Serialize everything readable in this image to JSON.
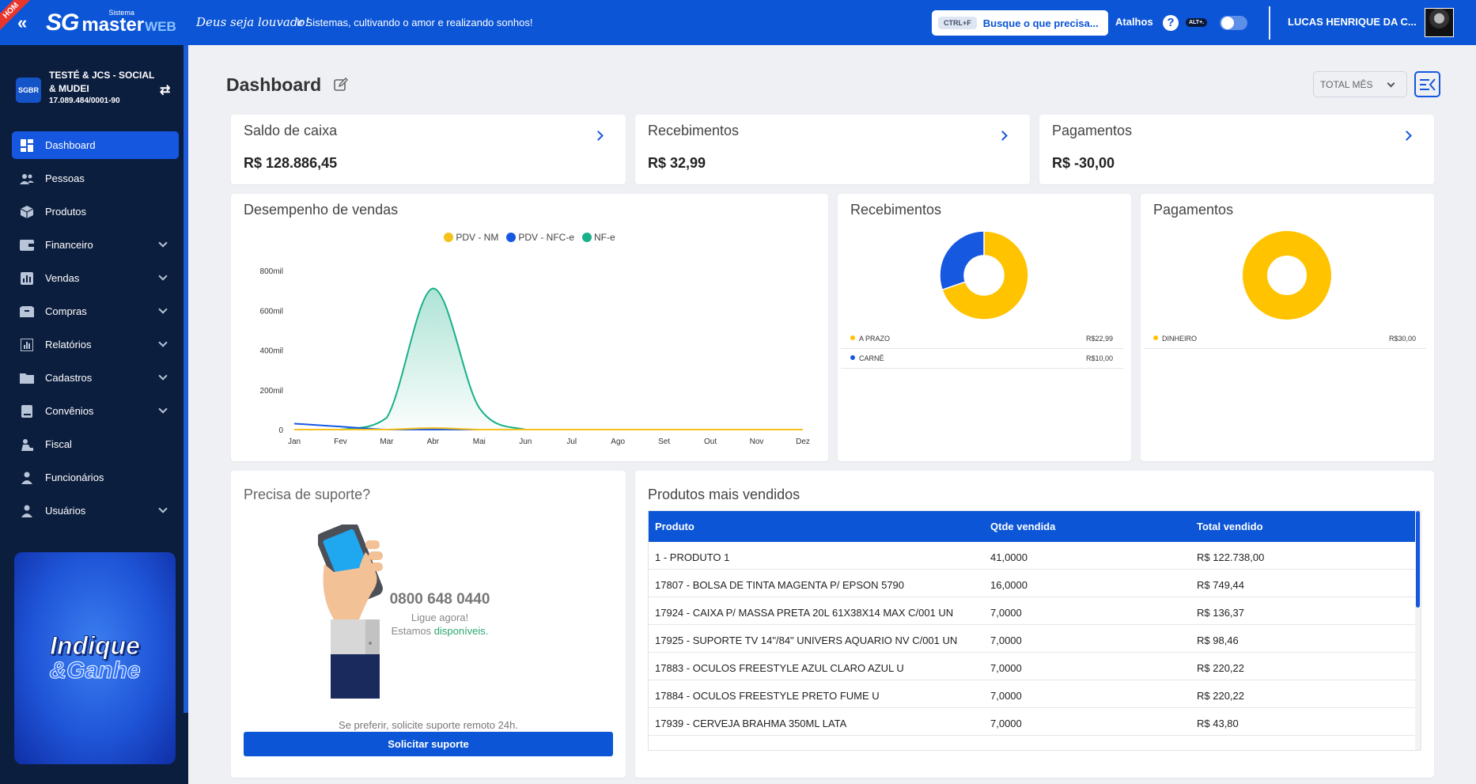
{
  "topbar": {
    "env_badge": "HOM",
    "logo_sg": "SG",
    "logo_sistema": "Sistema",
    "logo_master": "master",
    "logo_web": "WEB",
    "motto": "Deus seja louvado!",
    "tagline": "Ir Sistemas, cultivando o amor e realizando sonhos!",
    "search_shortcut": "CTRL+F",
    "search_placeholder": "Busque o que precisa...",
    "atalhos_label": "Atalhos",
    "help_shortcut": "ALT+.",
    "user_name": "LUCAS HENRIQUE DA C..."
  },
  "company": {
    "logo_text": "SGBR",
    "name": "TESTÉ & JCS - SOCIAL & MUDEI",
    "cnpj": "17.089.484/0001-90"
  },
  "menu": [
    {
      "label": "Dashboard",
      "icon": "dashboard-icon",
      "active": true,
      "expandable": false
    },
    {
      "label": "Pessoas",
      "icon": "people-icon",
      "active": false,
      "expandable": false
    },
    {
      "label": "Produtos",
      "icon": "box-icon",
      "active": false,
      "expandable": false
    },
    {
      "label": "Financeiro",
      "icon": "wallet-icon",
      "active": false,
      "expandable": true
    },
    {
      "label": "Vendas",
      "icon": "sales-icon",
      "active": false,
      "expandable": true
    },
    {
      "label": "Compras",
      "icon": "purchases-icon",
      "active": false,
      "expandable": true
    },
    {
      "label": "Relatórios",
      "icon": "report-icon",
      "active": false,
      "expandable": true
    },
    {
      "label": "Cadastros",
      "icon": "folder-icon",
      "active": false,
      "expandable": true
    },
    {
      "label": "Convênios",
      "icon": "book-icon",
      "active": false,
      "expandable": true
    },
    {
      "label": "Fiscal",
      "icon": "fiscal-icon",
      "active": false,
      "expandable": false
    },
    {
      "label": "Funcionários",
      "icon": "employee-icon",
      "active": false,
      "expandable": false
    },
    {
      "label": "Usuários",
      "icon": "user-icon",
      "active": false,
      "expandable": true
    }
  ],
  "promo": {
    "line1": "Indique",
    "line2": "&Ganhe"
  },
  "page": {
    "title": "Dashboard",
    "period": "TOTAL MÊS"
  },
  "summary": [
    {
      "title": "Saldo de caixa",
      "value": "R$ 128.886,45"
    },
    {
      "title": "Recebimentos",
      "value": "R$ 32,99"
    },
    {
      "title": "Pagamentos",
      "value": "R$ -30,00"
    }
  ],
  "sales_chart": {
    "title": "Desempenho de vendas",
    "chart_data": {
      "type": "area",
      "categories": [
        "Jan",
        "Fev",
        "Mar",
        "Abr",
        "Mai",
        "Jun",
        "Jul",
        "Ago",
        "Set",
        "Out",
        "Nov",
        "Dez"
      ],
      "y_ticks": [
        "0",
        "200mil",
        "400mil",
        "600mil",
        "800mil"
      ],
      "ylim": [
        0,
        800000
      ],
      "series": [
        {
          "name": "PDV - NM",
          "color": "#f6c11b",
          "values": [
            0,
            0,
            0,
            8000,
            0,
            0,
            0,
            0,
            0,
            0,
            0,
            0
          ]
        },
        {
          "name": "PDV - NFC-e",
          "color": "#1758e0",
          "values": [
            30000,
            15000,
            0,
            0,
            0,
            0,
            0,
            0,
            0,
            0,
            0,
            0
          ]
        },
        {
          "name": "NF-e",
          "color": "#19b089",
          "values": [
            0,
            0,
            60000,
            710000,
            110000,
            0,
            0,
            0,
            0,
            0,
            0,
            0
          ]
        }
      ]
    }
  },
  "receipts_chart": {
    "title": "Recebimentos",
    "chart_data": {
      "type": "pie",
      "slices": [
        {
          "label": "A PRAZO",
          "value": 22.99,
          "display": "R$22,99",
          "color": "#ffc300"
        },
        {
          "label": "CARNÊ",
          "value": 10.0,
          "display": "R$10,00",
          "color": "#1758e0"
        }
      ]
    }
  },
  "payments_chart": {
    "title": "Pagamentos",
    "chart_data": {
      "type": "pie",
      "slices": [
        {
          "label": "DINHEIRO",
          "value": 30.0,
          "display": "R$30,00",
          "color": "#ffc300"
        }
      ]
    }
  },
  "support": {
    "title": "Precisa de suporte?",
    "phone": "0800 648 0440",
    "call_now": "Ligue agora!",
    "available_prefix": "Estamos ",
    "available_highlight": "disponíveis.",
    "remote_text": "Se preferir, solicite suporte remoto 24h.",
    "button_label": "Solicitar suporte"
  },
  "products": {
    "title": "Produtos mais vendidos",
    "columns": [
      "Produto",
      "Qtde vendida",
      "Total vendido"
    ],
    "rows": [
      [
        "1 - PRODUTO 1",
        "41,0000",
        "R$ 122.738,00"
      ],
      [
        "17807 - BOLSA DE TINTA MAGENTA P/ EPSON 5790",
        "16,0000",
        "R$ 749,44"
      ],
      [
        "17924 - CAIXA P/ MASSA PRETA 20L 61X38X14 MAX C/001 UN",
        "7,0000",
        "R$ 136,37"
      ],
      [
        "17925 - SUPORTE TV 14\"/84\" UNIVERS AQUARIO NV C/001 UN",
        "7,0000",
        "R$ 98,46"
      ],
      [
        "17883 - OCULOS FREESTYLE AZUL CLARO AZUL U",
        "7,0000",
        "R$ 220,22"
      ],
      [
        "17884 - OCULOS FREESTYLE PRETO FUME U",
        "7,0000",
        "R$ 220,22"
      ],
      [
        "17939 - CERVEJA BRAHMA 350ML LATA",
        "7,0000",
        "R$ 43,80"
      ]
    ]
  }
}
